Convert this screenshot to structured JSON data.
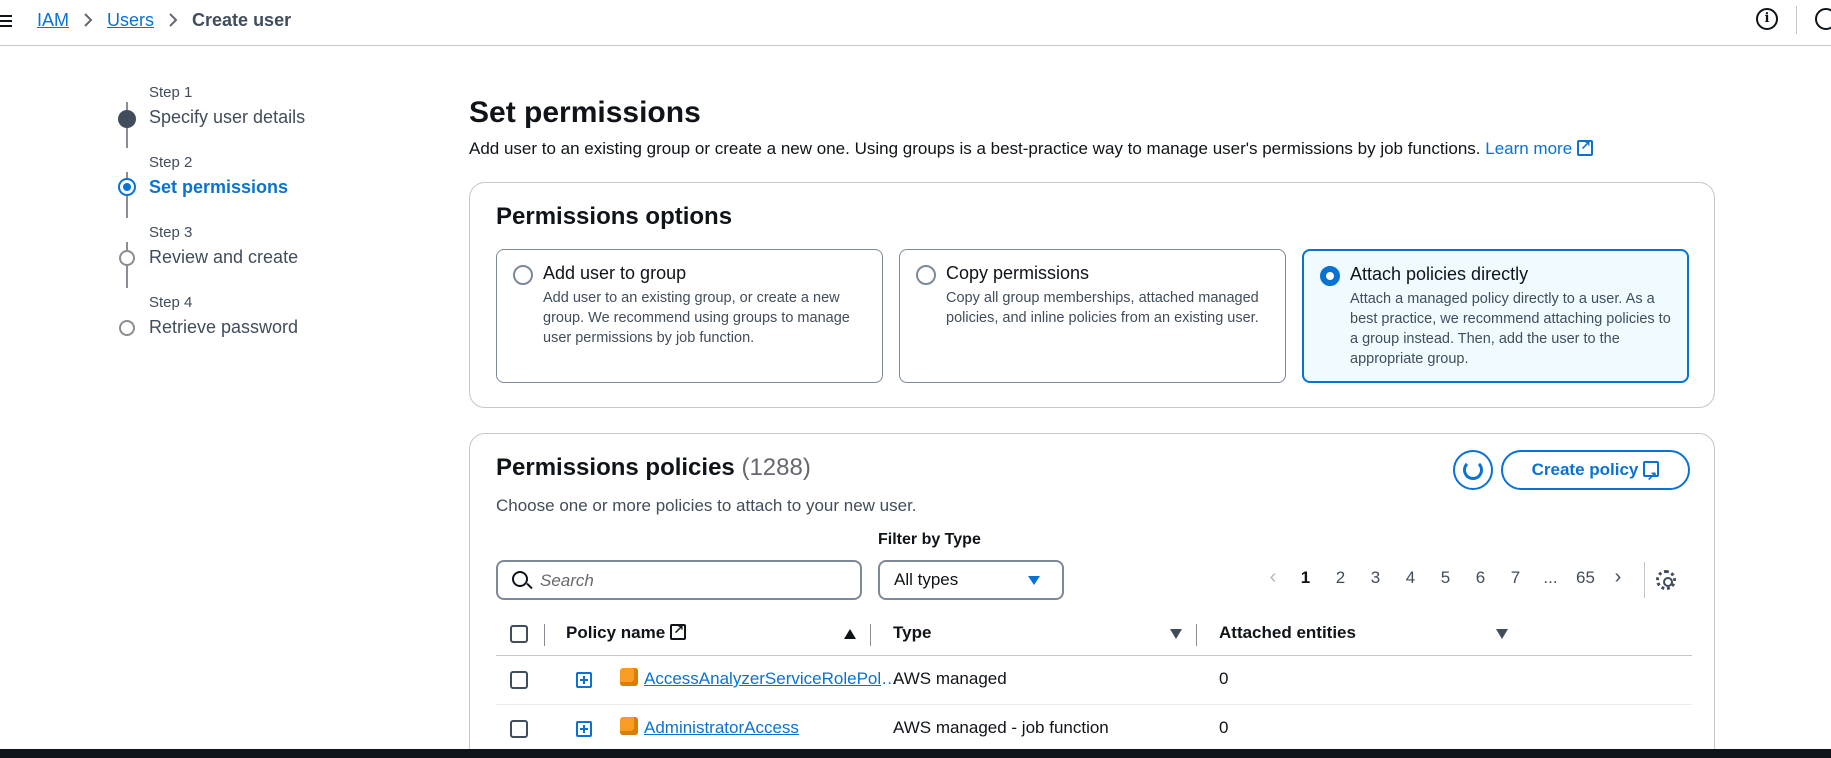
{
  "breadcrumb": {
    "items": [
      "IAM",
      "Users"
    ],
    "current": "Create user"
  },
  "steps": [
    {
      "num": "Step 1",
      "label": "Specify user details",
      "state": "done"
    },
    {
      "num": "Step 2",
      "label": "Set permissions",
      "state": "active"
    },
    {
      "num": "Step 3",
      "label": "Review and create",
      "state": "todo"
    },
    {
      "num": "Step 4",
      "label": "Retrieve password",
      "state": "todo"
    }
  ],
  "page": {
    "title": "Set permissions",
    "description": "Add user to an existing group or create a new one. Using groups is a best-practice way to manage user's permissions by job functions.",
    "learn_more": "Learn more"
  },
  "options": {
    "title": "Permissions options",
    "cards": [
      {
        "title": "Add user to group",
        "desc": "Add user to an existing group, or create a new group. We recommend using groups to manage user permissions by job function.",
        "selected": false
      },
      {
        "title": "Copy permissions",
        "desc": "Copy all group memberships, attached managed policies, and inline policies from an existing user.",
        "selected": false
      },
      {
        "title": "Attach policies directly",
        "desc": "Attach a managed policy directly to a user. As a best practice, we recommend attaching policies to a group instead. Then, add the user to the appropriate group.",
        "selected": true
      }
    ]
  },
  "policies": {
    "title": "Permissions policies",
    "count": "(1288)",
    "description": "Choose one or more policies to attach to your new user.",
    "create_label": "Create policy",
    "filter_label": "Filter by Type",
    "search_placeholder": "Search",
    "filter_value": "All types",
    "pagination": {
      "pages": [
        "1",
        "2",
        "3",
        "4",
        "5",
        "6",
        "7",
        "...",
        "65"
      ],
      "current": "1"
    },
    "columns": {
      "name": "Policy name",
      "type": "Type",
      "entities": "Attached entities"
    },
    "rows": [
      {
        "name": "AccessAnalyzerServiceRolePolicy",
        "type": "AWS managed",
        "entities": "0"
      },
      {
        "name": "AdministratorAccess",
        "type": "AWS managed - job function",
        "entities": "0"
      }
    ]
  },
  "colors": {
    "accent": "#0972d3",
    "selected_bg": "#f0fbff",
    "policy_icon": "#f89c24"
  },
  "icons": [
    "menu-icon",
    "chevron-right-icon",
    "info-icon",
    "external-link-icon",
    "refresh-icon",
    "search-icon",
    "caret-down-icon",
    "gear-icon",
    "expand-icon",
    "policy-cube-icon",
    "sort-icon"
  ]
}
